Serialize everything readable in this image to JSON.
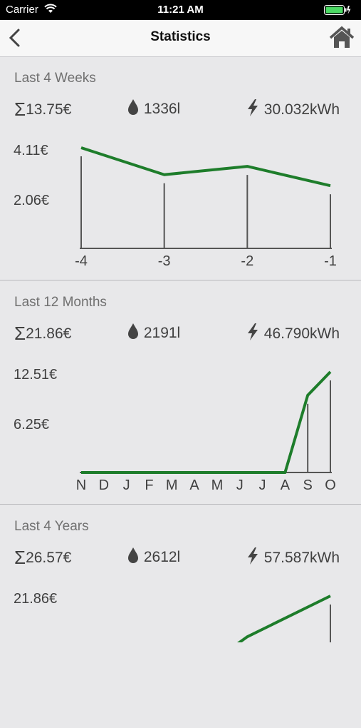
{
  "status_bar": {
    "carrier": "Carrier",
    "time": "11:21 AM"
  },
  "nav": {
    "title": "Statistics",
    "back_icon": "chevron-left-icon",
    "home_icon": "home-icon"
  },
  "colors": {
    "line": "#1e7d2b",
    "axis": "#555555"
  },
  "sections": [
    {
      "heading": "Last 4 Weeks",
      "cost": "13.75€",
      "water": "1336l",
      "energy": "30.032kWh",
      "y_max_label": "4.11€",
      "y_mid_label": "2.06€"
    },
    {
      "heading": "Last 12 Months",
      "cost": "21.86€",
      "water": "2191l",
      "energy": "46.790kWh",
      "y_max_label": "12.51€",
      "y_mid_label": "6.25€"
    },
    {
      "heading": "Last 4 Years",
      "cost": "26.57€",
      "water": "2612l",
      "energy": "57.587kWh",
      "y_max_label": "21.86€",
      "y_mid_label": ""
    }
  ],
  "chart_data": [
    {
      "type": "line",
      "categories": [
        "-4",
        "-3",
        "-2",
        "-1"
      ],
      "values": [
        4.11,
        3.01,
        3.35,
        2.56
      ],
      "ylim": [
        0,
        4.11
      ]
    },
    {
      "type": "line",
      "categories": [
        "N",
        "D",
        "J",
        "F",
        "M",
        "A",
        "M",
        "J",
        "J",
        "A",
        "S",
        "O"
      ],
      "values": [
        0,
        0,
        0,
        0,
        0,
        0,
        0,
        0,
        0,
        0,
        9.6,
        12.51
      ],
      "ylim": [
        0,
        12.51
      ]
    },
    {
      "type": "line",
      "categories": [
        "",
        "",
        "",
        ""
      ],
      "values": [
        0,
        0,
        13.0,
        21.86
      ],
      "ylim": [
        0,
        21.86
      ]
    }
  ]
}
